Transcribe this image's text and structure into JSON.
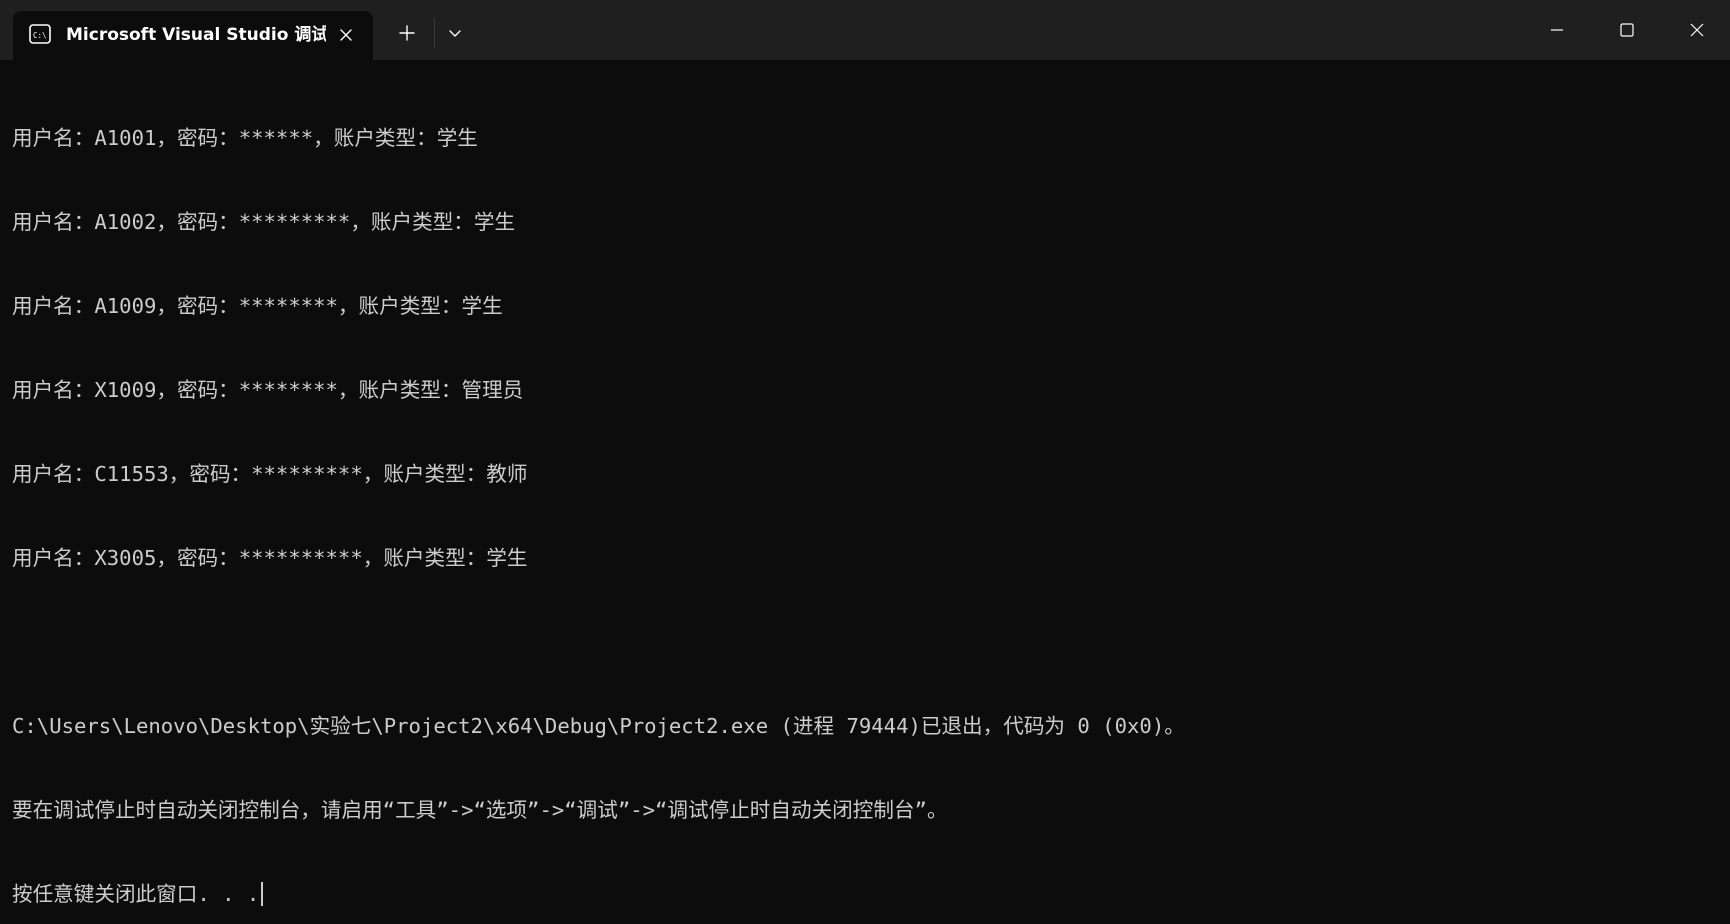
{
  "window": {
    "tab_title": "Microsoft Visual Studio 调试控",
    "tab_icon": "console-icon",
    "controls": [
      "new-tab-icon",
      "chevron-down-icon",
      "minimize-icon",
      "maximize-icon",
      "close-icon"
    ]
  },
  "colors": {
    "background": "#0c0c0c",
    "titlebar": "#1f1f1f",
    "text": "#cccccc"
  },
  "console": {
    "lines": [
      "用户名：A1001，密码：******，账户类型：学生",
      "用户名：A1002，密码：*********，账户类型：学生",
      "用户名：A1009，密码：********，账户类型：学生",
      "用户名：X1009，密码：********，账户类型：管理员",
      "用户名：C11553，密码：*********，账户类型：教师",
      "用户名：X3005，密码：**********，账户类型：学生",
      "",
      "C:\\Users\\Lenovo\\Desktop\\实验七\\Project2\\x64\\Debug\\Project2.exe (进程 79444)已退出，代码为 0 (0x0)。",
      "要在调试停止时自动关闭控制台，请启用“工具”->“选项”->“调试”->“调试停止时自动关闭控制台”。",
      "按任意键关闭此窗口. . ."
    ]
  }
}
